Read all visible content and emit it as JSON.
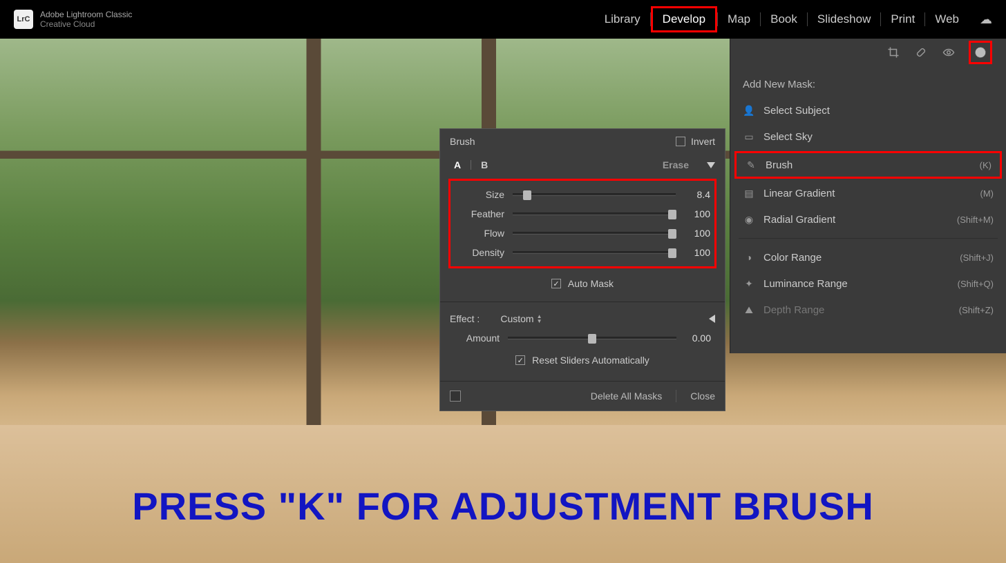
{
  "top": {
    "logo": "LrC",
    "app_line1": "Adobe Lightroom Classic",
    "app_line2": "Creative Cloud",
    "modules": [
      "Library",
      "Develop",
      "Map",
      "Book",
      "Slideshow",
      "Print",
      "Web"
    ],
    "active_module": "Develop"
  },
  "brush_panel": {
    "title": "Brush",
    "invert_label": "Invert",
    "invert_checked": false,
    "a_label": "A",
    "b_label": "B",
    "active_brush": "A",
    "erase_label": "Erase",
    "sliders": {
      "size": {
        "label": "Size",
        "value": "8.4",
        "pos": 9
      },
      "feather": {
        "label": "Feather",
        "value": "100",
        "pos": 98
      },
      "flow": {
        "label": "Flow",
        "value": "100",
        "pos": 98
      },
      "density": {
        "label": "Density",
        "value": "100",
        "pos": 98
      }
    },
    "auto_mask_label": "Auto Mask",
    "auto_mask_checked": true,
    "effect_label": "Effect :",
    "effect_value": "Custom",
    "amount": {
      "label": "Amount",
      "value": "0.00",
      "pos": 50
    },
    "reset_label": "Reset Sliders Automatically",
    "reset_checked": true,
    "delete_label": "Delete All Masks",
    "close_label": "Close"
  },
  "mask_panel": {
    "add_label": "Add New Mask:",
    "items": [
      {
        "label": "Select Subject",
        "shortcut": "",
        "icon": "person"
      },
      {
        "label": "Select Sky",
        "shortcut": "",
        "icon": "sky"
      },
      {
        "label": "Brush",
        "shortcut": "(K)",
        "icon": "brush",
        "highlight": true
      },
      {
        "label": "Linear Gradient",
        "shortcut": "(M)",
        "icon": "linear"
      },
      {
        "label": "Radial Gradient",
        "shortcut": "(Shift+M)",
        "icon": "radial"
      },
      {
        "label": "Color Range",
        "shortcut": "(Shift+J)",
        "icon": "color"
      },
      {
        "label": "Luminance Range",
        "shortcut": "(Shift+Q)",
        "icon": "luminance"
      },
      {
        "label": "Depth Range",
        "shortcut": "(Shift+Z)",
        "icon": "depth",
        "disabled": true
      }
    ]
  },
  "annotation": {
    "text": "PRESS \"K\"  FOR ADJUSTMENT BRUSH"
  }
}
